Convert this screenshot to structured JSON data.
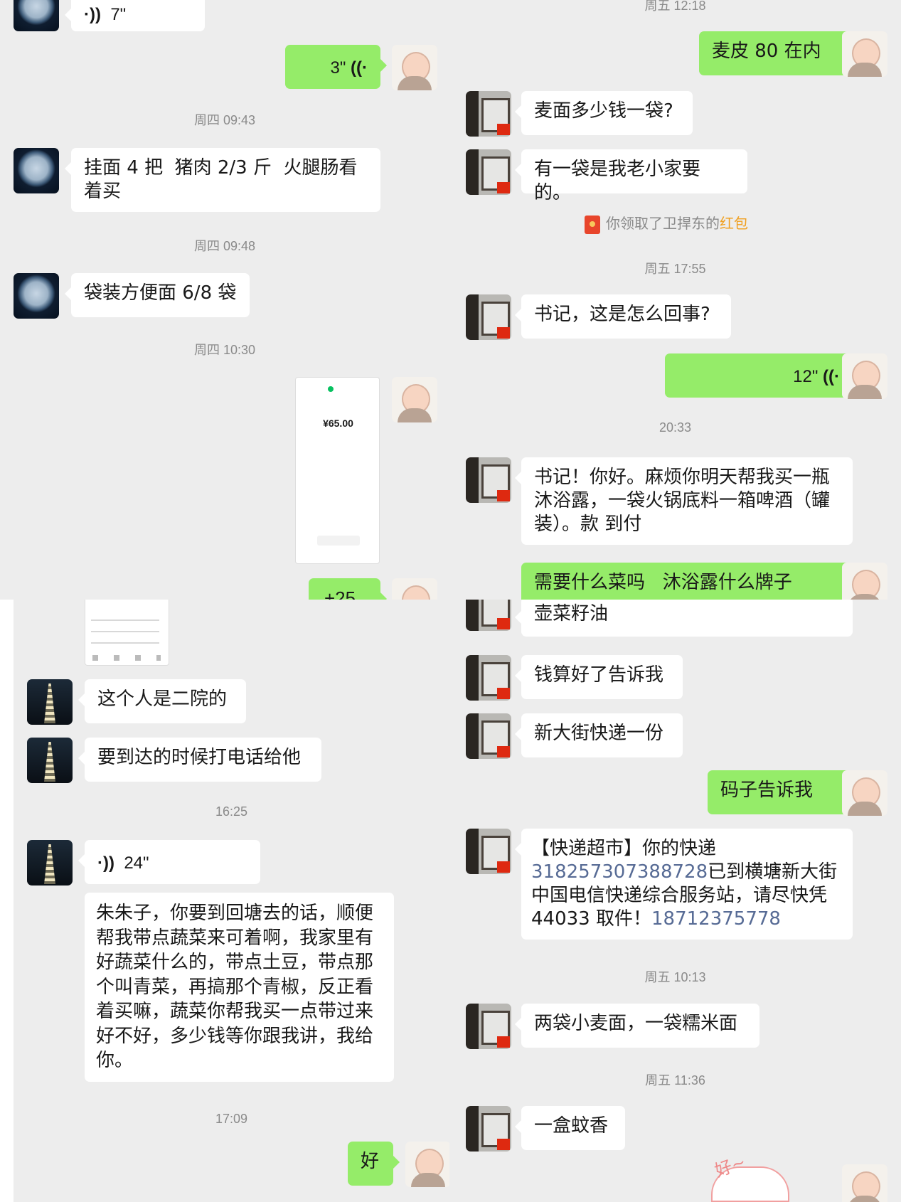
{
  "panel_top_left": {
    "voice_received_1": "7\"",
    "voice_sent_1": "3\"",
    "time_1": "周四 09:43",
    "msg_1": "挂面 4 把  猪肉 2/3 斤  火腿肠看着买",
    "time_2": "周四 09:48",
    "msg_2": "袋装方便面 6/8 袋",
    "time_3": "周四 10:30",
    "payment_shot": {
      "amount": "¥65.00"
    },
    "partial_sent": "+25"
  },
  "panel_top_right": {
    "time_0": "周五 12:18",
    "sent_1": "麦皮 80 在内",
    "msg_1": "麦面多少钱一袋?",
    "msg_2": "有一袋是我老小家要的。",
    "system_1": {
      "before": "你领取了卫捍东的",
      "highlight": "红包"
    },
    "time_1": "周五 17:55",
    "msg_3": "书记，这是怎么回事?",
    "voice_sent_1": "12\"",
    "time_2": "20:33",
    "msg_4": "书记！你好。麻烦你明天帮我买一瓶沐浴露，一袋火锅底料一箱啤酒（罐装）。款 到付",
    "sent_2": "需要什么菜吗   沐浴露什么牌子"
  },
  "panel_bottom_left": {
    "msg_1": "这个人是二院的",
    "msg_2": "要到达的时候打电话给他",
    "time_1": "16:25",
    "voice_1": "24\"",
    "msg_3": "朱朱子，你要到回塘去的话，顺便帮我带点蔬菜来可着啊，我家里有好蔬菜什么的，带点土豆，带点那个叫青菜，再搞那个青椒，反正看着买嘛，蔬菜你帮我买一点带过来好不好，多少钱等你跟我讲，我给你。",
    "time_2": "17:09",
    "sent_1": "好"
  },
  "panel_bottom_right": {
    "msg_0_tail": "壶菜籽油",
    "msg_1": "钱算好了告诉我",
    "msg_2": "新大街快递一份",
    "sent_1": "码子告诉我",
    "msg_3": {
      "part1": "【快递超市】你的快递",
      "tracking": "318257307388728",
      "part2": "已到横塘新大街中国电信快递综合服务站，请尽快凭 44033 取件！",
      "phone": "18712375778"
    },
    "time_1": "周五 10:13",
    "msg_4": "两袋小麦面，一袋糯米面",
    "time_2": "周五 11:36",
    "msg_5": "一盒蚊香",
    "sticker_text": "好~"
  }
}
